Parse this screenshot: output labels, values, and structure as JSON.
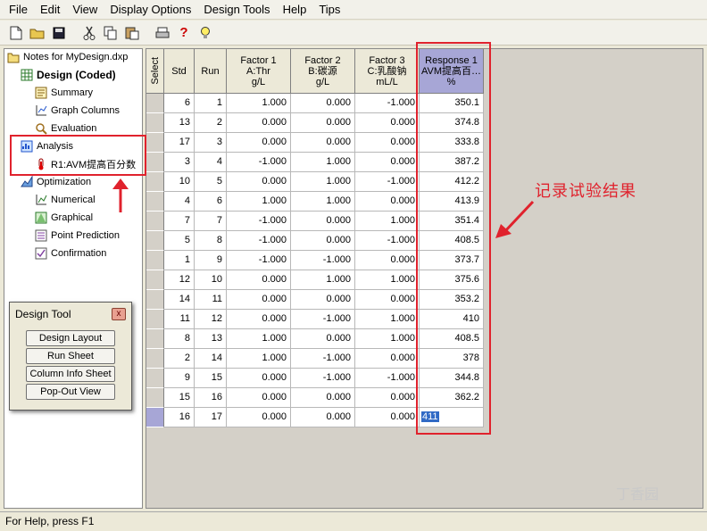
{
  "menu": [
    "File",
    "Edit",
    "View",
    "Display Options",
    "Design Tools",
    "Help",
    "Tips"
  ],
  "toolbar_icons": [
    "new-file-icon",
    "open-folder-icon",
    "save-icon",
    "cut-icon",
    "copy-icon",
    "paste-icon",
    "print-icon",
    "help-icon",
    "tip-lightbulb-icon"
  ],
  "tree": {
    "root": "Notes for MyDesign.dxp",
    "design": "Design (Coded)",
    "summary": "Summary",
    "graph_columns": "Graph Columns",
    "evaluation": "Evaluation",
    "analysis": "Analysis",
    "r1": "R1:AVM提高百分数",
    "optimization": "Optimization",
    "numerical": "Numerical",
    "graphical": "Graphical",
    "point_prediction": "Point Prediction",
    "confirmation": "Confirmation"
  },
  "grid": {
    "select_header": "Select",
    "std_header": "Std",
    "run_header": "Run",
    "factor1": {
      "l1": "Factor 1",
      "l2": "A:Thr",
      "l3": "g/L"
    },
    "factor2": {
      "l1": "Factor 2",
      "l2": "B:碳源",
      "l3": "g/L"
    },
    "factor3": {
      "l1": "Factor 3",
      "l2": "C:乳酸钠",
      "l3": "mL/L"
    },
    "response1": {
      "l1": "Response 1",
      "l2": "AVM提高百…",
      "l3": "%"
    },
    "rows": [
      [
        "6",
        "1",
        "1.000",
        "0.000",
        "-1.000",
        "350.1"
      ],
      [
        "13",
        "2",
        "0.000",
        "0.000",
        "0.000",
        "374.8"
      ],
      [
        "17",
        "3",
        "0.000",
        "0.000",
        "0.000",
        "333.8"
      ],
      [
        "3",
        "4",
        "-1.000",
        "1.000",
        "0.000",
        "387.2"
      ],
      [
        "10",
        "5",
        "0.000",
        "1.000",
        "-1.000",
        "412.2"
      ],
      [
        "4",
        "6",
        "1.000",
        "1.000",
        "0.000",
        "413.9"
      ],
      [
        "7",
        "7",
        "-1.000",
        "0.000",
        "1.000",
        "351.4"
      ],
      [
        "5",
        "8",
        "-1.000",
        "0.000",
        "-1.000",
        "408.5"
      ],
      [
        "1",
        "9",
        "-1.000",
        "-1.000",
        "0.000",
        "373.7"
      ],
      [
        "12",
        "10",
        "0.000",
        "1.000",
        "1.000",
        "375.6"
      ],
      [
        "14",
        "11",
        "0.000",
        "0.000",
        "0.000",
        "353.2"
      ],
      [
        "11",
        "12",
        "0.000",
        "-1.000",
        "1.000",
        "410"
      ],
      [
        "8",
        "13",
        "1.000",
        "0.000",
        "1.000",
        "408.5"
      ],
      [
        "2",
        "14",
        "1.000",
        "-1.000",
        "0.000",
        "378"
      ],
      [
        "9",
        "15",
        "0.000",
        "-1.000",
        "-1.000",
        "344.8"
      ],
      [
        "15",
        "16",
        "0.000",
        "0.000",
        "0.000",
        "362.2"
      ],
      [
        "16",
        "17",
        "0.000",
        "0.000",
        "0.000",
        "411"
      ]
    ]
  },
  "dialog": {
    "title": "Design Tool",
    "close": "x",
    "buttons": [
      "Design Layout",
      "Run Sheet",
      "Column Info Sheet",
      "Pop-Out View"
    ]
  },
  "annotation": "记录试验结果",
  "status": "For Help, press F1",
  "watermark": "丁香园",
  "colors": {
    "accent_red": "#e0222d",
    "selected_header": "#a7a6d6",
    "selected_cell": "#316ac5"
  }
}
